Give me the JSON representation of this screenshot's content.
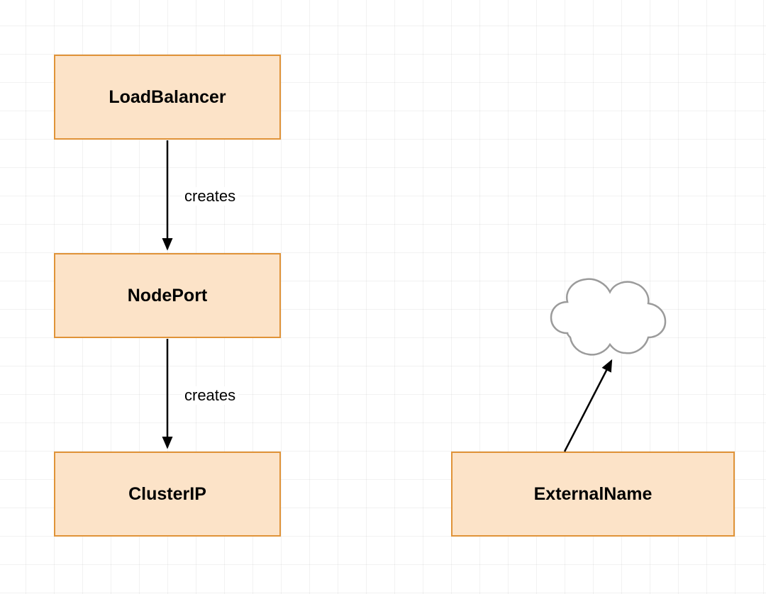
{
  "diagram": {
    "nodes": {
      "load_balancer": {
        "label": "LoadBalancer"
      },
      "node_port": {
        "label": "NodePort"
      },
      "cluster_ip": {
        "label": "ClusterIP"
      },
      "external_name": {
        "label": "ExternalName"
      },
      "cloud": {
        "label": ""
      }
    },
    "edges": {
      "lb_to_nodeport": {
        "label": "creates"
      },
      "nodeport_to_clusterip": {
        "label": "creates"
      }
    }
  }
}
